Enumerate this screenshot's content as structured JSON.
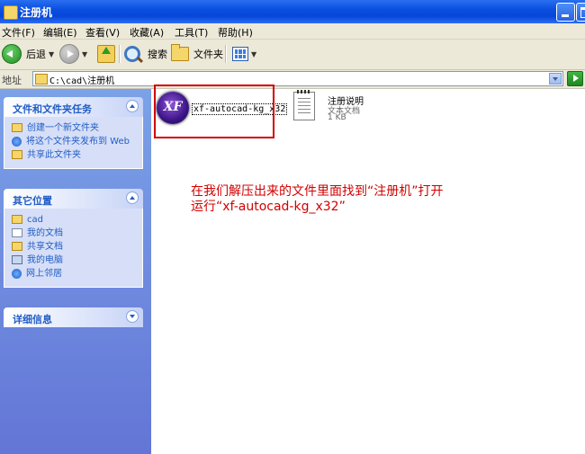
{
  "window": {
    "title": "注册机"
  },
  "menu": [
    "文件(F)",
    "编辑(E)",
    "查看(V)",
    "收藏(A)",
    "工具(T)",
    "帮助(H)"
  ],
  "toolbar": {
    "back_label": "后退",
    "search_label": "搜索",
    "folders_label": "文件夹"
  },
  "address": {
    "label": "地址",
    "path": "C:\\cad\\注册机"
  },
  "tasks_panel": {
    "title": "文件和文件夹任务",
    "items": [
      "创建一个新文件夹",
      "将这个文件夹发布到 Web",
      "共享此文件夹"
    ]
  },
  "places_panel": {
    "title": "其它位置",
    "items": [
      "cad",
      "我的文档",
      "共享文档",
      "我的电脑",
      "网上邻居"
    ]
  },
  "details_panel": {
    "title": "详细信息"
  },
  "files": [
    {
      "name": "xf-autocad-kg_x32",
      "icon_text": "XF"
    },
    {
      "name": "注册说明",
      "type": "文本文档",
      "size": "1 KB"
    }
  ],
  "annotation": {
    "line1": "在我们解压出来的文件里面找到“注册机”打开",
    "line2": "运行“xf-autocad-kg_x32”"
  },
  "colors": {
    "title_bar": "#0a4fe0",
    "task_pane": "#6f8fe0",
    "annotation": "#d20000",
    "highlight": "#d20000"
  }
}
